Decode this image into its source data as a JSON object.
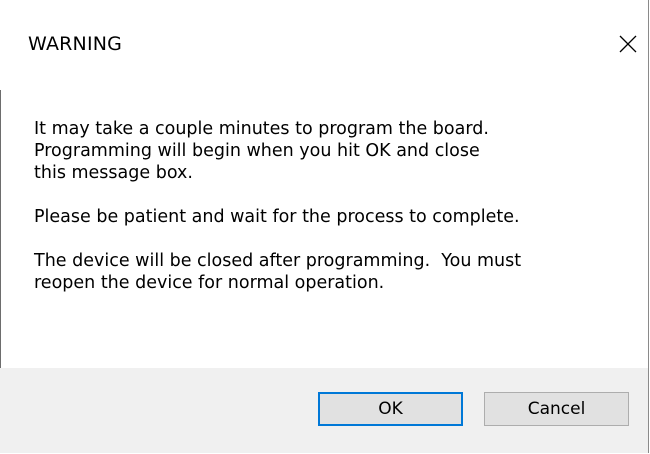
{
  "dialog": {
    "title": "WARNING",
    "message_paragraphs": [
      [
        "It may take a couple minutes to program the board.",
        "Programming will begin when you hit OK and close",
        "this message box."
      ],
      [
        "Please be patient and wait for the process to complete."
      ],
      [
        "The device will be closed after programming.  You must",
        "reopen the device for normal operation."
      ]
    ],
    "buttons": {
      "ok_label": "OK",
      "cancel_label": "Cancel"
    },
    "close_icon": "close-icon",
    "colors": {
      "footer_bg": "#f0f0f0",
      "default_button_border": "#0078d7",
      "button_bg": "#e1e1e1"
    }
  }
}
